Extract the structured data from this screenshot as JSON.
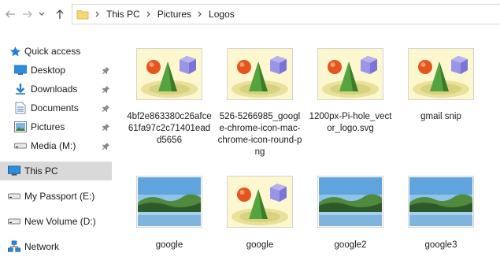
{
  "address_bar": {
    "breadcrumbs": [
      "This PC",
      "Pictures",
      "Logos"
    ]
  },
  "sidebar": {
    "items": [
      {
        "label": "Quick access",
        "icon": "star-icon",
        "pinned": false
      },
      {
        "label": "Desktop",
        "icon": "desktop-icon",
        "pinned": true
      },
      {
        "label": "Downloads",
        "icon": "download-icon",
        "pinned": true
      },
      {
        "label": "Documents",
        "icon": "documents-icon",
        "pinned": true
      },
      {
        "label": "Pictures",
        "icon": "pictures-icon",
        "pinned": true
      },
      {
        "label": "Media (M:)",
        "icon": "drive-icon",
        "pinned": true
      },
      {
        "label": "This PC",
        "icon": "computer-icon",
        "pinned": false,
        "selected": true
      },
      {
        "label": "My Passport (E:)",
        "icon": "drive-icon",
        "pinned": false
      },
      {
        "label": "New Volume (D:)",
        "icon": "drive-icon",
        "pinned": false
      },
      {
        "label": "Network",
        "icon": "network-icon",
        "pinned": false
      }
    ]
  },
  "files": [
    {
      "name": "4bf2e863380c26afce61fa97c2c71401eadd5656",
      "thumb": "generic-image-thumbnail"
    },
    {
      "name": "526-5266985_google-chrome-icon-mac-chrome-icon-round-png",
      "thumb": "generic-image-thumbnail"
    },
    {
      "name": "1200px-Pi-hole_vector_logo.svg",
      "thumb": "generic-image-thumbnail"
    },
    {
      "name": "gmail snip",
      "thumb": "generic-image-thumbnail"
    },
    {
      "name": "google",
      "thumb": "landscape-thumbnail"
    },
    {
      "name": "google",
      "thumb": "generic-image-thumbnail"
    },
    {
      "name": "google2",
      "thumb": "landscape-thumbnail"
    },
    {
      "name": "google3",
      "thumb": "landscape-thumbnail"
    }
  ],
  "colors": {
    "selected_bg": "#d9d9d9",
    "accent_blue": "#1e78d7",
    "folder_yellow": "#f8d775"
  }
}
